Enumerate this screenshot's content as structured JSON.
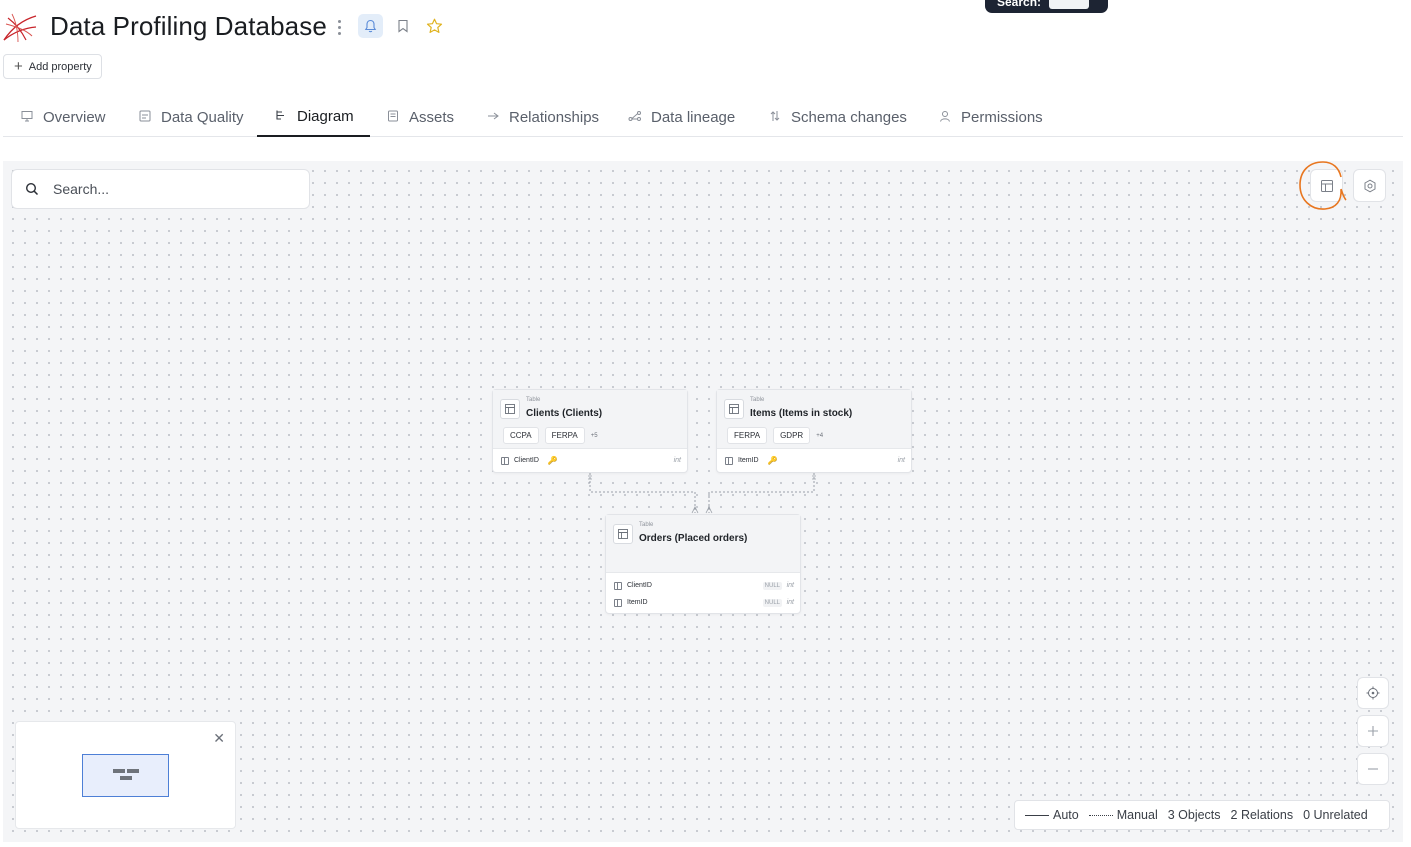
{
  "header": {
    "title": "Data Profiling Database",
    "add_property_label": "Add property",
    "search_tooltip_label": "Search:"
  },
  "tabs": [
    {
      "label": "Overview",
      "icon": "monitor-icon"
    },
    {
      "label": "Data Quality",
      "icon": "data-quality-icon"
    },
    {
      "label": "Diagram",
      "icon": "diagram-icon",
      "active": true
    },
    {
      "label": "Assets",
      "icon": "assets-icon"
    },
    {
      "label": "Relationships",
      "icon": "relationships-icon"
    },
    {
      "label": "Data lineage",
      "icon": "lineage-icon"
    },
    {
      "label": "Schema changes",
      "icon": "schema-changes-icon"
    },
    {
      "label": "Permissions",
      "icon": "permissions-icon"
    }
  ],
  "canvas": {
    "search_placeholder": "Search..."
  },
  "nodes": {
    "clients": {
      "type": "Table",
      "name": "Clients (Clients)",
      "tags": [
        "CCPA",
        "FERPA"
      ],
      "more": "+5",
      "columns": [
        {
          "name": "ClientID",
          "key": true,
          "type": "int"
        }
      ]
    },
    "items": {
      "type": "Table",
      "name": "Items (Items in stock)",
      "tags": [
        "FERPA",
        "GDPR"
      ],
      "more": "+4",
      "columns": [
        {
          "name": "ItemID",
          "key": true,
          "type": "int"
        }
      ]
    },
    "orders": {
      "type": "Table",
      "name": "Orders (Placed orders)",
      "columns": [
        {
          "name": "ClientID",
          "null": "NULL",
          "type": "int"
        },
        {
          "name": "ItemID",
          "null": "NULL",
          "type": "int"
        }
      ]
    }
  },
  "legend": {
    "auto": "Auto",
    "manual": "Manual",
    "objects": "3 Objects",
    "relations": "2 Relations",
    "unrelated": "0 Unrelated"
  },
  "colors": {
    "accent": "#4d7fd6",
    "highlight": "#e8761f",
    "star": "#e0b320",
    "logo": "#c8242b"
  }
}
